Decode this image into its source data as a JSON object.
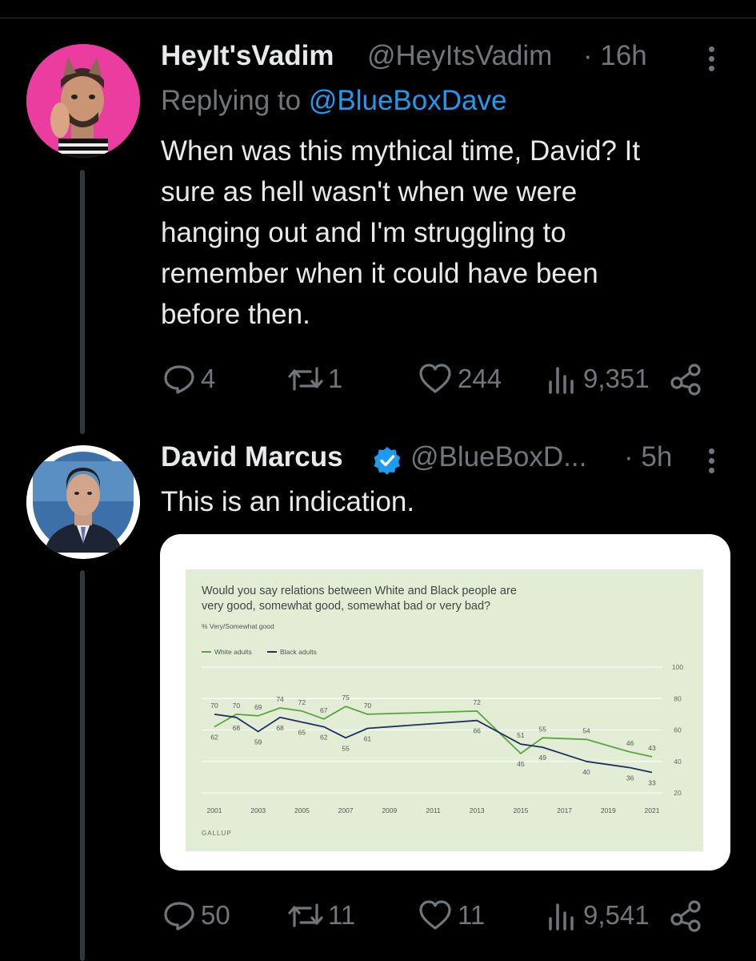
{
  "tweets": [
    {
      "display_name": "HeyIt'sVadim",
      "handle": "@HeyItsVadim",
      "time": "· 16h",
      "replying_prefix": "Replying to",
      "replying_to": "@BlueBoxDave",
      "text_lines": [
        "When was this mythical time, David? It",
        "sure as hell wasn't when we were",
        "hanging out and I'm struggling to",
        "remember when it could have been",
        "before then."
      ],
      "replies": "4",
      "reposts": "1",
      "likes": "244",
      "views": "9,351"
    },
    {
      "display_name": "David Marcus",
      "handle": "@BlueBoxD...",
      "time": "· 5h",
      "text": "This is an indication.",
      "replies": "50",
      "reposts": "11",
      "likes": "11",
      "views": "9,541"
    }
  ],
  "icons": {
    "reply": "speech-bubble-icon",
    "repost": "repost-arrows-icon",
    "like": "heart-icon",
    "views": "bar-chart-icon",
    "share": "share-nodes-icon",
    "more": "vertical-dots-icon",
    "verified": "verified-badge-icon"
  },
  "colors": {
    "background": "#000000",
    "text": "#e7e9ea",
    "muted": "#71767b",
    "link": "#1d9bf0",
    "chart_bg": "#e3edd6",
    "white_line": "#5aa53b",
    "black_line": "#1e2f63"
  },
  "chart_data": {
    "type": "line",
    "title_lines": [
      "Would you say relations between White and Black people are",
      "very good, somewhat good, somewhat bad or very bad?"
    ],
    "subtitle": "% Very/Somewhat good",
    "source": "GALLUP",
    "x_ticks": [
      "2001",
      "2003",
      "2005",
      "2007",
      "2009",
      "2011",
      "2013",
      "2015",
      "2017",
      "2019",
      "2021"
    ],
    "y_ticks": [
      "100",
      "80",
      "60",
      "40",
      "20"
    ],
    "ylim": [
      20,
      100
    ],
    "xlim": [
      2001,
      2021
    ],
    "series": [
      {
        "name": "White adults",
        "color": "#5aa53b",
        "points": [
          [
            2001,
            62
          ],
          [
            2002,
            70
          ],
          [
            2003,
            69
          ],
          [
            2004,
            74
          ],
          [
            2005,
            72
          ],
          [
            2006,
            67
          ],
          [
            2007,
            75
          ],
          [
            2008,
            70
          ],
          [
            2013,
            72
          ],
          [
            2015,
            45
          ],
          [
            2016,
            55
          ],
          [
            2018,
            54
          ],
          [
            2020,
            46
          ],
          [
            2021,
            43
          ]
        ],
        "labels": [
          "62",
          "70",
          "69",
          "74",
          "72",
          "67",
          "75",
          "70",
          "72",
          "45",
          "55",
          "54",
          "46",
          "43"
        ]
      },
      {
        "name": "Black adults",
        "color": "#1e2f63",
        "points": [
          [
            2001,
            70
          ],
          [
            2002,
            68
          ],
          [
            2003,
            59
          ],
          [
            2004,
            68
          ],
          [
            2005,
            65
          ],
          [
            2006,
            62
          ],
          [
            2007,
            55
          ],
          [
            2008,
            61
          ],
          [
            2013,
            66
          ],
          [
            2015,
            51
          ],
          [
            2016,
            49
          ],
          [
            2018,
            40
          ],
          [
            2020,
            36
          ],
          [
            2021,
            33
          ]
        ],
        "labels": [
          "70",
          "68",
          "59",
          "68",
          "65",
          "62",
          "55",
          "61",
          "66",
          "51",
          "49",
          "40",
          "36",
          "33"
        ]
      }
    ]
  }
}
